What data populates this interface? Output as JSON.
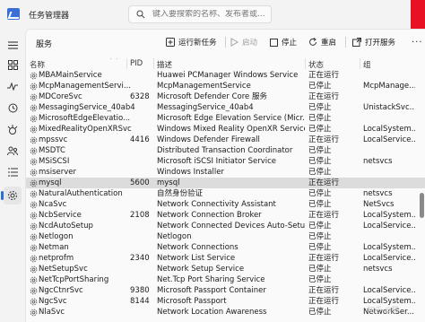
{
  "app": {
    "title": "任务管理器",
    "search_placeholder": "键入要搜索的名称、发布者或...",
    "accent": "#2b6fd6"
  },
  "nav": {
    "items": [
      "menu-icon",
      "processes-icon",
      "performance-icon",
      "history-icon",
      "startup-icon",
      "users-icon",
      "details-icon",
      "services-icon"
    ],
    "active": "services-icon"
  },
  "toolbar": {
    "page_title": "服务",
    "run_new_task": "运行新任务",
    "start": "启动",
    "stop": "停止",
    "restart": "重启",
    "open_services": "打开服务",
    "more": "···"
  },
  "table": {
    "columns": [
      "名称",
      "PID",
      "描述",
      "状态",
      "组"
    ],
    "rows": [
      {
        "name": "MBAMainService",
        "pid": "",
        "desc": "Huawei PCManager Windows Service",
        "status": "正在运行",
        "group": ""
      },
      {
        "name": "McpManagementServi...",
        "pid": "",
        "desc": "McpManagementService",
        "status": "已停止",
        "group": "McpManage..."
      },
      {
        "name": "MDCoreSvc",
        "pid": "6328",
        "desc": "Microsoft Defender Core 服务",
        "status": "正在运行",
        "group": ""
      },
      {
        "name": "MessagingService_40ab4",
        "pid": "",
        "desc": "MessagingService_40ab4",
        "status": "已停止",
        "group": "UnistackSvc..."
      },
      {
        "name": "MicrosoftEdgeElevatio...",
        "pid": "",
        "desc": "Microsoft Edge Elevation Service (Micr...",
        "status": "已停止",
        "group": ""
      },
      {
        "name": "MixedRealityOpenXRSvc",
        "pid": "",
        "desc": "Windows Mixed Reality OpenXR Service",
        "status": "已停止",
        "group": "LocalSystem..."
      },
      {
        "name": "mpssvc",
        "pid": "4416",
        "desc": "Windows Defender Firewall",
        "status": "正在运行",
        "group": "LocalService..."
      },
      {
        "name": "MSDTC",
        "pid": "",
        "desc": "Distributed Transaction Coordinator",
        "status": "已停止",
        "group": ""
      },
      {
        "name": "MSiSCSI",
        "pid": "",
        "desc": "Microsoft iSCSI Initiator Service",
        "status": "已停止",
        "group": "netsvcs"
      },
      {
        "name": "msiserver",
        "pid": "",
        "desc": "Windows Installer",
        "status": "已停止",
        "group": ""
      },
      {
        "name": "mysql",
        "pid": "5600",
        "desc": "mysql",
        "status": "正在运行",
        "group": "",
        "selected": true
      },
      {
        "name": "NaturalAuthentication",
        "pid": "",
        "desc": "自然身份验证",
        "status": "已停止",
        "group": "netsvcs"
      },
      {
        "name": "NcaSvc",
        "pid": "",
        "desc": "Network Connectivity Assistant",
        "status": "已停止",
        "group": "NetSvcs"
      },
      {
        "name": "NcbService",
        "pid": "2108",
        "desc": "Network Connection Broker",
        "status": "正在运行",
        "group": "LocalSystem..."
      },
      {
        "name": "NcdAutoSetup",
        "pid": "",
        "desc": "Network Connected Devices Auto-Setup",
        "status": "已停止",
        "group": "LocalService..."
      },
      {
        "name": "Netlogon",
        "pid": "",
        "desc": "Netlogon",
        "status": "已停止",
        "group": ""
      },
      {
        "name": "Netman",
        "pid": "",
        "desc": "Network Connections",
        "status": "已停止",
        "group": "LocalSystem..."
      },
      {
        "name": "netprofm",
        "pid": "2340",
        "desc": "Network List Service",
        "status": "正在运行",
        "group": "LocalService..."
      },
      {
        "name": "NetSetupSvc",
        "pid": "",
        "desc": "Network Setup Service",
        "status": "已停止",
        "group": "netsvcs"
      },
      {
        "name": "NetTcpPortSharing",
        "pid": "",
        "desc": "Net.Tcp Port Sharing Service",
        "status": "已停止",
        "group": ""
      },
      {
        "name": "NgcCtnrSvc",
        "pid": "9380",
        "desc": "Microsoft Passport Container",
        "status": "正在运行",
        "group": "LocalService..."
      },
      {
        "name": "NgcSvc",
        "pid": "8144",
        "desc": "Microsoft Passport",
        "status": "正在运行",
        "group": "LocalSystem..."
      },
      {
        "name": "NlaSvc",
        "pid": "",
        "desc": "Network Location Awareness",
        "status": "已停止",
        "group": "NetworkSer..."
      }
    ]
  },
  "watermark": "知乎 @聂"
}
